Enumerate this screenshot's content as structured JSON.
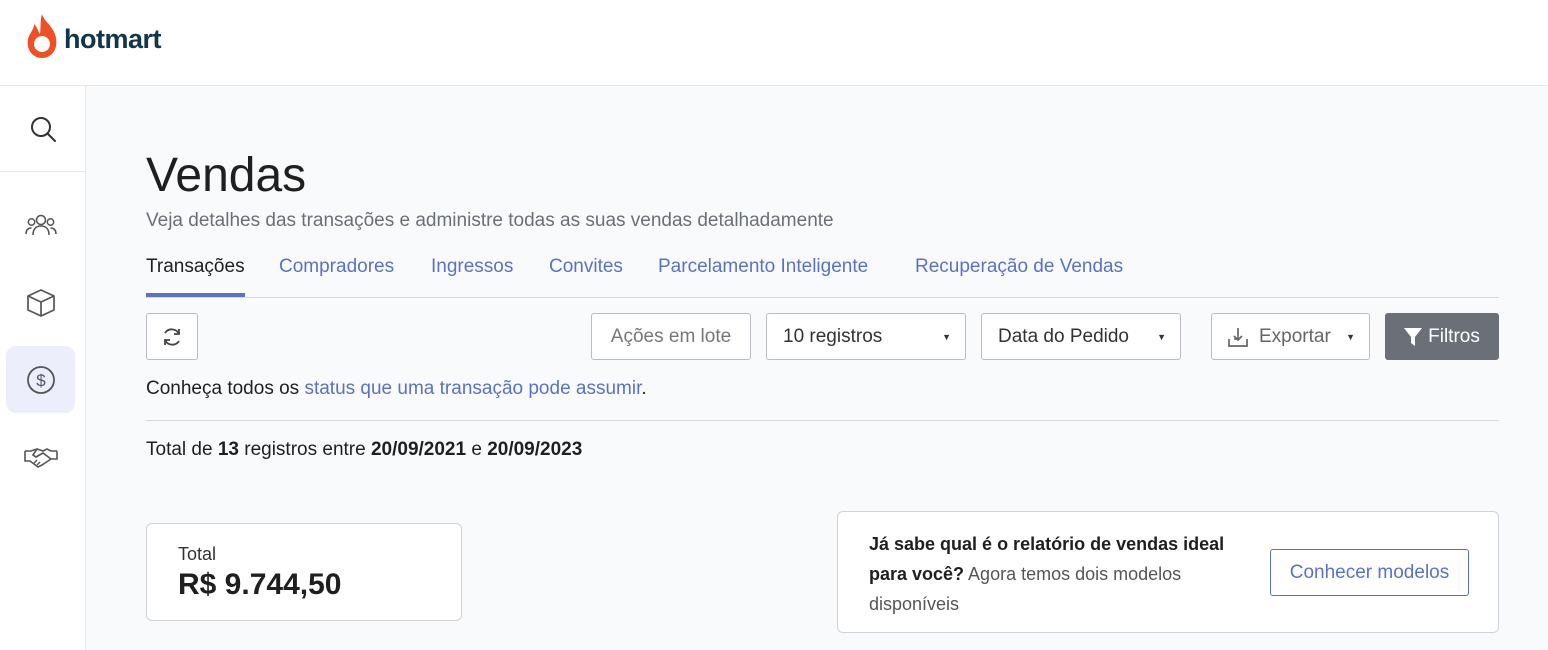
{
  "brand": {
    "name": "hotmart",
    "flame_color": "#f04e23",
    "text_color": "#11354a"
  },
  "sidebar": {
    "items": [
      {
        "icon": "search-icon"
      },
      {
        "icon": "users-icon"
      },
      {
        "icon": "box-icon"
      },
      {
        "icon": "dollar-icon",
        "active": true
      },
      {
        "icon": "handshake-icon"
      }
    ]
  },
  "page": {
    "title": "Vendas",
    "subtitle": "Veja detalhes das transações e administre todas as suas vendas detalhadamente"
  },
  "tabs": [
    {
      "label": "Transações",
      "active": true
    },
    {
      "label": "Compradores"
    },
    {
      "label": "Ingressos"
    },
    {
      "label": "Convites"
    },
    {
      "label": "Parcelamento Inteligente"
    },
    {
      "label": "Recuperação de Vendas"
    }
  ],
  "toolbar": {
    "refresh_icon": "refresh-icon",
    "batch_actions": "Ações em lote",
    "records_select": "10 registros",
    "date_select": "Data do Pedido",
    "export": "Exportar",
    "filters": "Filtros"
  },
  "status_info": {
    "prefix": "Conheça todos os ",
    "link": "status que uma transação pode assumir",
    "suffix": "."
  },
  "totals": {
    "prefix": "Total de ",
    "count": "13",
    "middle": " registros entre ",
    "date_from": "20/09/2021",
    "connector": " e ",
    "date_to": "20/09/2023"
  },
  "total_card": {
    "label": "Total",
    "value": "R$ 9.744,50"
  },
  "promo": {
    "bold_text": "Já sabe qual é o relatório de vendas ideal para você?",
    "text": " Agora temos dois modelos disponíveis",
    "button": "Conhecer modelos"
  },
  "colors": {
    "accent": "#5b72c4",
    "filter_button": "#6b7078",
    "active_sidebar_bg": "#eceefc"
  }
}
